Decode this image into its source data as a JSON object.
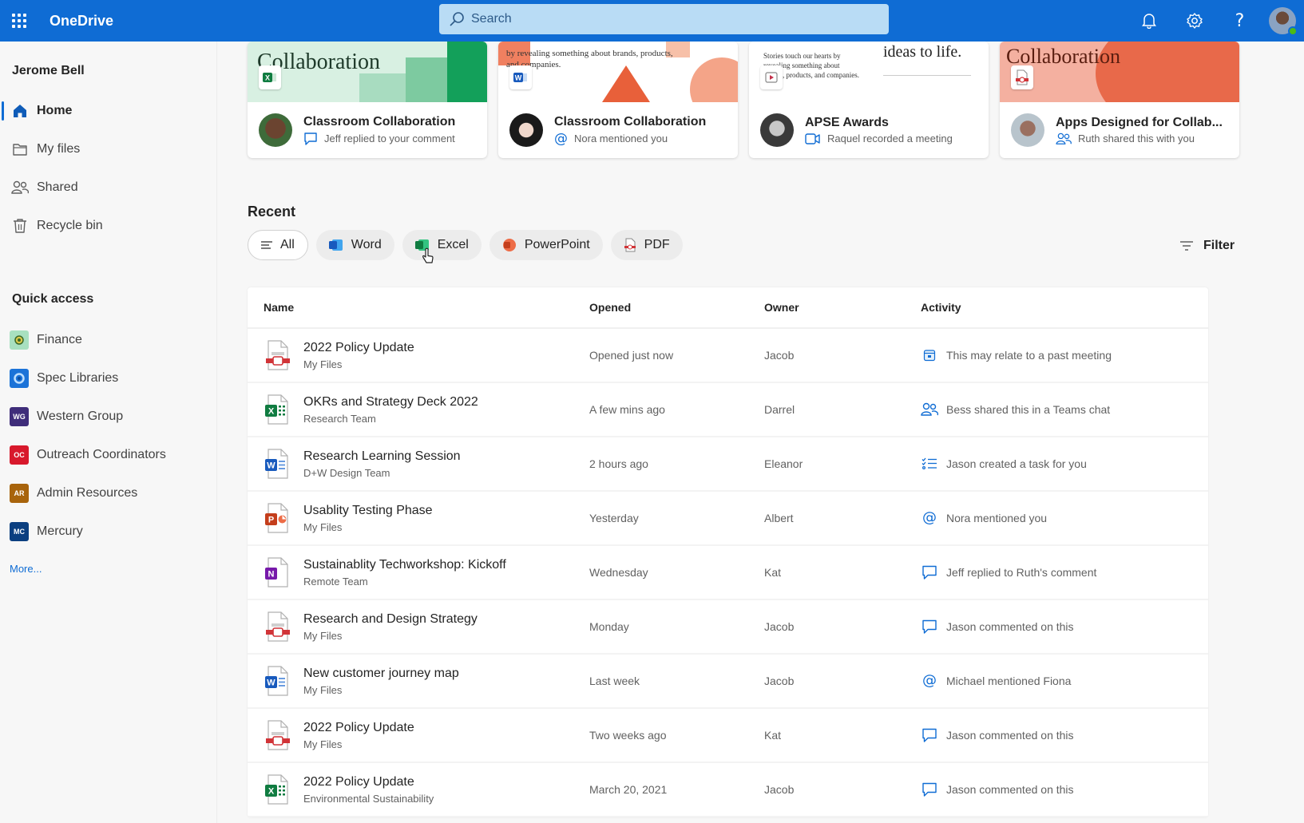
{
  "app": {
    "title": "OneDrive"
  },
  "search": {
    "placeholder": "Search"
  },
  "header_icons": [
    "bell-icon",
    "gear-icon",
    "help-icon",
    "avatar"
  ],
  "colors": {
    "brand": "#0f6cd4",
    "word": "#185abd",
    "excel": "#107c41",
    "powerpoint": "#c43e1c",
    "pdf": "#d13438",
    "onenote": "#7719aa"
  },
  "sidebar": {
    "user_name": "Jerome Bell",
    "nav": [
      {
        "label": "Home",
        "icon": "home-icon",
        "active": true
      },
      {
        "label": "My files",
        "icon": "folder-icon",
        "active": false
      },
      {
        "label": "Shared",
        "icon": "people-icon",
        "active": false
      },
      {
        "label": "Recycle bin",
        "icon": "trash-icon",
        "active": false
      }
    ],
    "quick_access_title": "Quick access",
    "quick_access": [
      {
        "label": "Finance",
        "badge": "",
        "color": "#a8e0c0"
      },
      {
        "label": "Spec Libraries",
        "badge": "",
        "color": "#1b73d8"
      },
      {
        "label": "Western Group",
        "badge": "WG",
        "color": "#3f2d7a"
      },
      {
        "label": "Outreach Coordinators",
        "badge": "OC",
        "color": "#d8192c"
      },
      {
        "label": "Admin Resources",
        "badge": "AR",
        "color": "#a8640c"
      },
      {
        "label": "Mercury",
        "badge": "MC",
        "color": "#0b3f80"
      }
    ],
    "more_label": "More..."
  },
  "cards": [
    {
      "title": "Classroom Collaboration",
      "activity": "Jeff replied to your comment",
      "activity_icon": "comment-icon",
      "file_type": "excel",
      "thumb_text": "Collaboration"
    },
    {
      "title": "Classroom Collaboration",
      "activity": "Nora mentioned you",
      "activity_icon": "mention-icon",
      "file_type": "word",
      "thumb_text": "by revealing something about brands, products, and companies."
    },
    {
      "title": "APSE Awards",
      "activity": "Raquel recorded a meeting",
      "activity_icon": "video-icon",
      "file_type": "video",
      "thumb_text": "ideas to life."
    },
    {
      "title": "Apps Designed for Collab...",
      "activity": "Ruth shared this with you",
      "activity_icon": "people-icon",
      "file_type": "pdf",
      "thumb_text": "Collaboration"
    }
  ],
  "recent": {
    "title": "Recent",
    "filters": [
      {
        "label": "All",
        "selected": true
      },
      {
        "label": "Word",
        "selected": false
      },
      {
        "label": "Excel",
        "selected": false
      },
      {
        "label": "PowerPoint",
        "selected": false
      },
      {
        "label": "PDF",
        "selected": false
      }
    ],
    "filter_button": "Filter",
    "columns": {
      "name": "Name",
      "opened": "Opened",
      "owner": "Owner",
      "activity": "Activity"
    },
    "rows": [
      {
        "name": "2022 Policy Update",
        "location": "My Files",
        "type": "pdf",
        "opened": "Opened just now",
        "owner": "Jacob",
        "activity": "This may relate to a past meeting",
        "activity_icon": "calendar-icon"
      },
      {
        "name": "OKRs and Strategy Deck 2022",
        "location": "Research Team",
        "type": "excel",
        "opened": "A few mins ago",
        "owner": "Darrel",
        "activity": "Bess shared this in a Teams chat",
        "activity_icon": "people-icon"
      },
      {
        "name": "Research Learning Session",
        "location": "D+W Design Team",
        "type": "word",
        "opened": "2 hours ago",
        "owner": "Eleanor",
        "activity": "Jason created a task for you",
        "activity_icon": "task-icon"
      },
      {
        "name": "Usablity Testing Phase",
        "location": "My Files",
        "type": "powerpoint",
        "opened": "Yesterday",
        "owner": "Albert",
        "activity": "Nora mentioned you",
        "activity_icon": "mention-icon"
      },
      {
        "name": "Sustainablity Techworkshop: Kickoff",
        "location": "Remote Team",
        "type": "onenote",
        "opened": "Wednesday",
        "owner": "Kat",
        "activity": "Jeff replied to Ruth's comment",
        "activity_icon": "comment-icon"
      },
      {
        "name": "Research and Design Strategy",
        "location": "My Files",
        "type": "pdf",
        "opened": "Monday",
        "owner": "Jacob",
        "activity": "Jason commented on this",
        "activity_icon": "comment-icon"
      },
      {
        "name": "New customer journey map",
        "location": "My Files",
        "type": "word",
        "opened": "Last week",
        "owner": "Jacob",
        "activity": "Michael mentioned Fiona",
        "activity_icon": "mention-icon"
      },
      {
        "name": "2022 Policy Update",
        "location": "My Files",
        "type": "pdf",
        "opened": "Two weeks ago",
        "owner": "Kat",
        "activity": "Jason commented on this",
        "activity_icon": "comment-icon"
      },
      {
        "name": "2022 Policy Update",
        "location": "Environmental Sustainability",
        "type": "excel",
        "opened": "March 20, 2021",
        "owner": "Jacob",
        "activity": "Jason commented on this",
        "activity_icon": "comment-icon"
      }
    ]
  }
}
